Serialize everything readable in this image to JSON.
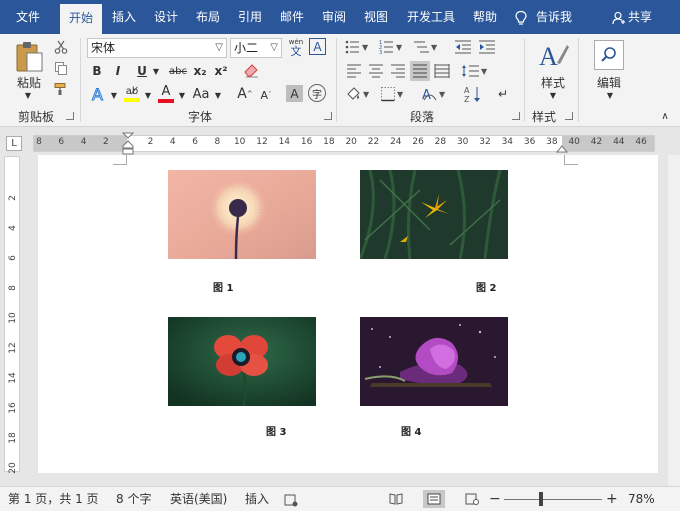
{
  "tabs": [
    {
      "label": "文件"
    },
    {
      "label": "开始"
    },
    {
      "label": "插入"
    },
    {
      "label": "设计"
    },
    {
      "label": "布局"
    },
    {
      "label": "引用"
    },
    {
      "label": "邮件"
    },
    {
      "label": "审阅"
    },
    {
      "label": "视图"
    },
    {
      "label": "开发工具"
    },
    {
      "label": "帮助"
    }
  ],
  "active_tab": "开始",
  "tell_me": "告诉我",
  "share": "共享",
  "ribbon": {
    "clipboard": {
      "group_label": "剪贴板",
      "paste_label": "粘贴"
    },
    "font": {
      "group_label": "字体",
      "font_name": "宋体",
      "font_size": "小二",
      "bold": "B",
      "italic": "I",
      "underline": "U",
      "strike": "abc",
      "subscript": "x₂",
      "superscript": "x²",
      "change_case": "Aa",
      "grow": "A",
      "shrink": "A",
      "phonetic": "wén",
      "phonetic_char": "文",
      "char_border": "A",
      "char_shading": "A",
      "enclose": "字"
    },
    "paragraph": {
      "group_label": "段落"
    },
    "styles": {
      "group_label": "样式",
      "styles_label": "样式"
    },
    "editing": {
      "editing_label": "编辑"
    },
    "colors": {
      "highlight": "#ffff00",
      "font_color": "#e81123",
      "accent": "#2b579a"
    }
  },
  "ruler": {
    "corner": "L",
    "h_ticks": [
      "8",
      "6",
      "4",
      "2",
      "2",
      "4",
      "6",
      "8",
      "10",
      "12",
      "14",
      "16",
      "18",
      "20",
      "22",
      "24",
      "26",
      "28",
      "30",
      "32",
      "34",
      "36",
      "38",
      "40",
      "42",
      "44",
      "46"
    ],
    "v_ticks": [
      "2",
      "4",
      "6",
      "8",
      "10",
      "12",
      "14",
      "16",
      "18",
      "20"
    ]
  },
  "document": {
    "figures": [
      {
        "caption": "图 1",
        "subject": "dandelion"
      },
      {
        "caption": "图 2",
        "subject": "yellow-lily"
      },
      {
        "caption": "图 3",
        "subject": "red-poppy"
      },
      {
        "caption": "图 4",
        "subject": "purple-flower"
      }
    ]
  },
  "status": {
    "page": "第 1 页，共 1 页",
    "words": "8 个字",
    "language": "英语(美国)",
    "mode": "插入",
    "zoom": "78%",
    "zoom_level": 0.78
  }
}
